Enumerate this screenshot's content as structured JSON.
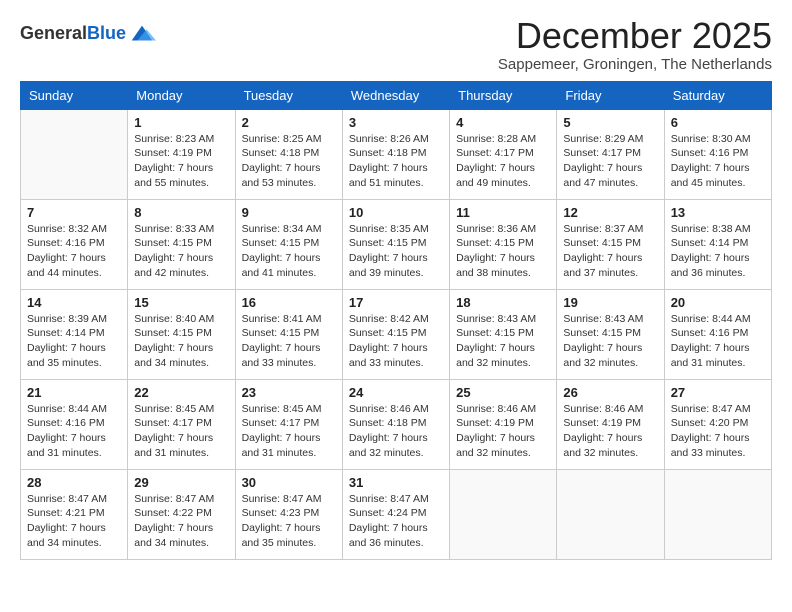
{
  "logo": {
    "general": "General",
    "blue": "Blue"
  },
  "header": {
    "month": "December 2025",
    "subtitle": "Sappemeer, Groningen, The Netherlands"
  },
  "weekdays": [
    "Sunday",
    "Monday",
    "Tuesday",
    "Wednesday",
    "Thursday",
    "Friday",
    "Saturday"
  ],
  "weeks": [
    [
      {
        "day": "",
        "sunrise": "",
        "sunset": "",
        "daylight": ""
      },
      {
        "day": "1",
        "sunrise": "Sunrise: 8:23 AM",
        "sunset": "Sunset: 4:19 PM",
        "daylight": "Daylight: 7 hours and 55 minutes."
      },
      {
        "day": "2",
        "sunrise": "Sunrise: 8:25 AM",
        "sunset": "Sunset: 4:18 PM",
        "daylight": "Daylight: 7 hours and 53 minutes."
      },
      {
        "day": "3",
        "sunrise": "Sunrise: 8:26 AM",
        "sunset": "Sunset: 4:18 PM",
        "daylight": "Daylight: 7 hours and 51 minutes."
      },
      {
        "day": "4",
        "sunrise": "Sunrise: 8:28 AM",
        "sunset": "Sunset: 4:17 PM",
        "daylight": "Daylight: 7 hours and 49 minutes."
      },
      {
        "day": "5",
        "sunrise": "Sunrise: 8:29 AM",
        "sunset": "Sunset: 4:17 PM",
        "daylight": "Daylight: 7 hours and 47 minutes."
      },
      {
        "day": "6",
        "sunrise": "Sunrise: 8:30 AM",
        "sunset": "Sunset: 4:16 PM",
        "daylight": "Daylight: 7 hours and 45 minutes."
      }
    ],
    [
      {
        "day": "7",
        "sunrise": "Sunrise: 8:32 AM",
        "sunset": "Sunset: 4:16 PM",
        "daylight": "Daylight: 7 hours and 44 minutes."
      },
      {
        "day": "8",
        "sunrise": "Sunrise: 8:33 AM",
        "sunset": "Sunset: 4:15 PM",
        "daylight": "Daylight: 7 hours and 42 minutes."
      },
      {
        "day": "9",
        "sunrise": "Sunrise: 8:34 AM",
        "sunset": "Sunset: 4:15 PM",
        "daylight": "Daylight: 7 hours and 41 minutes."
      },
      {
        "day": "10",
        "sunrise": "Sunrise: 8:35 AM",
        "sunset": "Sunset: 4:15 PM",
        "daylight": "Daylight: 7 hours and 39 minutes."
      },
      {
        "day": "11",
        "sunrise": "Sunrise: 8:36 AM",
        "sunset": "Sunset: 4:15 PM",
        "daylight": "Daylight: 7 hours and 38 minutes."
      },
      {
        "day": "12",
        "sunrise": "Sunrise: 8:37 AM",
        "sunset": "Sunset: 4:15 PM",
        "daylight": "Daylight: 7 hours and 37 minutes."
      },
      {
        "day": "13",
        "sunrise": "Sunrise: 8:38 AM",
        "sunset": "Sunset: 4:14 PM",
        "daylight": "Daylight: 7 hours and 36 minutes."
      }
    ],
    [
      {
        "day": "14",
        "sunrise": "Sunrise: 8:39 AM",
        "sunset": "Sunset: 4:14 PM",
        "daylight": "Daylight: 7 hours and 35 minutes."
      },
      {
        "day": "15",
        "sunrise": "Sunrise: 8:40 AM",
        "sunset": "Sunset: 4:15 PM",
        "daylight": "Daylight: 7 hours and 34 minutes."
      },
      {
        "day": "16",
        "sunrise": "Sunrise: 8:41 AM",
        "sunset": "Sunset: 4:15 PM",
        "daylight": "Daylight: 7 hours and 33 minutes."
      },
      {
        "day": "17",
        "sunrise": "Sunrise: 8:42 AM",
        "sunset": "Sunset: 4:15 PM",
        "daylight": "Daylight: 7 hours and 33 minutes."
      },
      {
        "day": "18",
        "sunrise": "Sunrise: 8:43 AM",
        "sunset": "Sunset: 4:15 PM",
        "daylight": "Daylight: 7 hours and 32 minutes."
      },
      {
        "day": "19",
        "sunrise": "Sunrise: 8:43 AM",
        "sunset": "Sunset: 4:15 PM",
        "daylight": "Daylight: 7 hours and 32 minutes."
      },
      {
        "day": "20",
        "sunrise": "Sunrise: 8:44 AM",
        "sunset": "Sunset: 4:16 PM",
        "daylight": "Daylight: 7 hours and 31 minutes."
      }
    ],
    [
      {
        "day": "21",
        "sunrise": "Sunrise: 8:44 AM",
        "sunset": "Sunset: 4:16 PM",
        "daylight": "Daylight: 7 hours and 31 minutes."
      },
      {
        "day": "22",
        "sunrise": "Sunrise: 8:45 AM",
        "sunset": "Sunset: 4:17 PM",
        "daylight": "Daylight: 7 hours and 31 minutes."
      },
      {
        "day": "23",
        "sunrise": "Sunrise: 8:45 AM",
        "sunset": "Sunset: 4:17 PM",
        "daylight": "Daylight: 7 hours and 31 minutes."
      },
      {
        "day": "24",
        "sunrise": "Sunrise: 8:46 AM",
        "sunset": "Sunset: 4:18 PM",
        "daylight": "Daylight: 7 hours and 32 minutes."
      },
      {
        "day": "25",
        "sunrise": "Sunrise: 8:46 AM",
        "sunset": "Sunset: 4:19 PM",
        "daylight": "Daylight: 7 hours and 32 minutes."
      },
      {
        "day": "26",
        "sunrise": "Sunrise: 8:46 AM",
        "sunset": "Sunset: 4:19 PM",
        "daylight": "Daylight: 7 hours and 32 minutes."
      },
      {
        "day": "27",
        "sunrise": "Sunrise: 8:47 AM",
        "sunset": "Sunset: 4:20 PM",
        "daylight": "Daylight: 7 hours and 33 minutes."
      }
    ],
    [
      {
        "day": "28",
        "sunrise": "Sunrise: 8:47 AM",
        "sunset": "Sunset: 4:21 PM",
        "daylight": "Daylight: 7 hours and 34 minutes."
      },
      {
        "day": "29",
        "sunrise": "Sunrise: 8:47 AM",
        "sunset": "Sunset: 4:22 PM",
        "daylight": "Daylight: 7 hours and 34 minutes."
      },
      {
        "day": "30",
        "sunrise": "Sunrise: 8:47 AM",
        "sunset": "Sunset: 4:23 PM",
        "daylight": "Daylight: 7 hours and 35 minutes."
      },
      {
        "day": "31",
        "sunrise": "Sunrise: 8:47 AM",
        "sunset": "Sunset: 4:24 PM",
        "daylight": "Daylight: 7 hours and 36 minutes."
      },
      {
        "day": "",
        "sunrise": "",
        "sunset": "",
        "daylight": ""
      },
      {
        "day": "",
        "sunrise": "",
        "sunset": "",
        "daylight": ""
      },
      {
        "day": "",
        "sunrise": "",
        "sunset": "",
        "daylight": ""
      }
    ]
  ]
}
